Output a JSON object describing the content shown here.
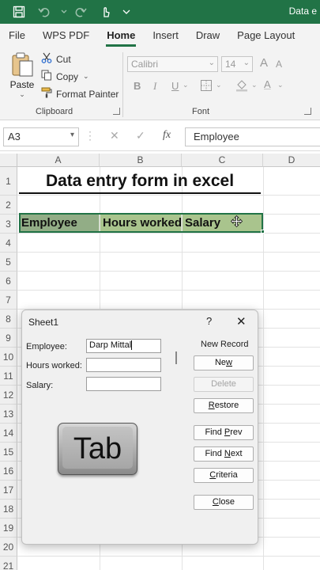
{
  "titlebar": {
    "title": "Data e"
  },
  "ribbon_tabs": [
    "File",
    "WPS PDF",
    "Home",
    "Insert",
    "Draw",
    "Page Layout"
  ],
  "active_tab": "Home",
  "clipboard": {
    "paste_label": "Paste",
    "cut_label": "Cut",
    "copy_label": "Copy",
    "format_painter_label": "Format Painter",
    "group_label": "Clipboard"
  },
  "font": {
    "family_value": "Calibri",
    "size_value": "14",
    "bold": "B",
    "italic": "I",
    "underline": "U",
    "grow": "A",
    "shrink": "A",
    "font_color": "A",
    "group_label": "Font"
  },
  "formula_bar": {
    "cell_ref": "A3",
    "fx_label": "fx",
    "value": "Employee"
  },
  "columns": [
    "A",
    "B",
    "C",
    "D"
  ],
  "rows": [
    "1",
    "2",
    "3",
    "4",
    "5",
    "6",
    "7",
    "8",
    "9",
    "10",
    "11",
    "12",
    "13",
    "14",
    "15",
    "16",
    "17",
    "18",
    "19",
    "20",
    "21"
  ],
  "sheet": {
    "title": "Data entry form in excel",
    "headers": [
      "Employee",
      "Hours worked",
      "Salary"
    ]
  },
  "dialog": {
    "title": "Sheet1",
    "help": "?",
    "close": "✕",
    "fields": [
      {
        "label": "Employee:",
        "value": "Darp Mittal"
      },
      {
        "label": "Hours worked:",
        "value": ""
      },
      {
        "label": "Salary:",
        "value": ""
      }
    ],
    "record_label": "New Record",
    "buttons": [
      {
        "label": "New",
        "enabled": true
      },
      {
        "label": "Delete",
        "enabled": false
      },
      {
        "label": "Restore",
        "enabled": true
      },
      {
        "label": "Find Prev",
        "enabled": true
      },
      {
        "label": "Find Next",
        "enabled": true
      },
      {
        "label": "Criteria",
        "enabled": true
      },
      {
        "label": "Close",
        "enabled": true
      }
    ],
    "key_overlay": "Tab"
  },
  "colors": {
    "excel_green": "#217346",
    "header_fill": "#a9c48d"
  }
}
